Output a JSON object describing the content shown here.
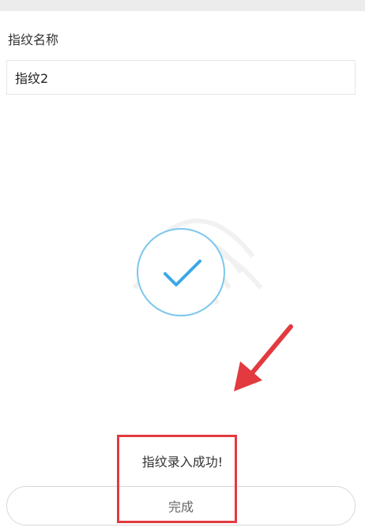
{
  "fingerprint_name": {
    "label": "指纹名称",
    "value": "指纹2"
  },
  "status": {
    "icon": "check-icon",
    "message": "指纹录入成功!"
  },
  "actions": {
    "done_label": "完成"
  },
  "colors": {
    "check_accent": "#7cc7ee",
    "annotation": "#e23a3f",
    "input_border": "#e6e6e6"
  }
}
